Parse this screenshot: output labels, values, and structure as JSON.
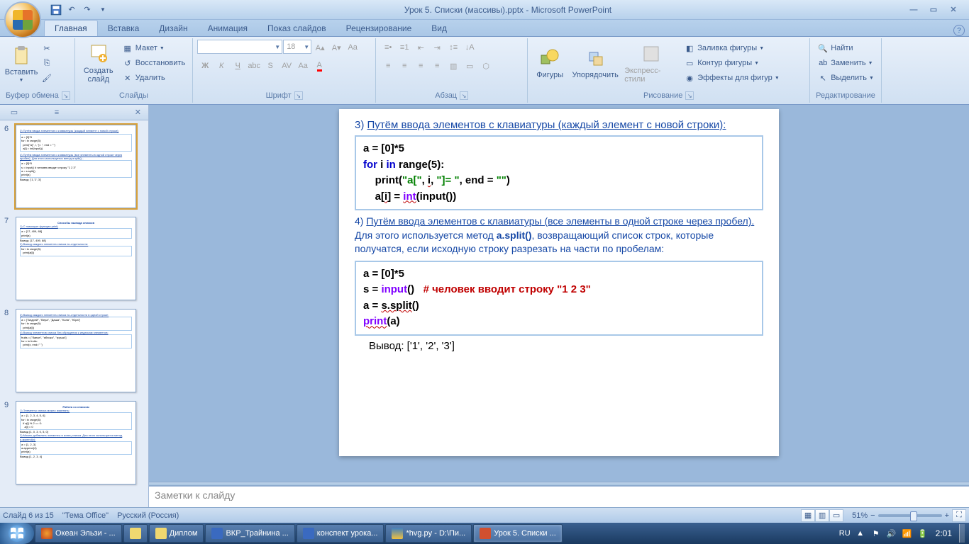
{
  "title": "Урок 5. Списки (массивы).pptx - Microsoft PowerPoint",
  "tabs": {
    "home": "Главная",
    "insert": "Вставка",
    "design": "Дизайн",
    "anim": "Анимация",
    "show": "Показ слайдов",
    "review": "Рецензирование",
    "view": "Вид"
  },
  "ribbon": {
    "clipboard": {
      "label": "Буфер обмена",
      "paste": "Вставить"
    },
    "slides": {
      "label": "Слайды",
      "new": "Создать\nслайд",
      "layout": "Макет",
      "reset": "Восстановить",
      "delete": "Удалить"
    },
    "font": {
      "label": "Шрифт",
      "size": "18"
    },
    "para": {
      "label": "Абзац"
    },
    "draw": {
      "label": "Рисование",
      "shapes": "Фигуры",
      "arrange": "Упорядочить",
      "styles": "Экспресс-стили",
      "fill": "Заливка фигуры",
      "outline": "Контур фигуры",
      "effects": "Эффекты для фигур"
    },
    "edit": {
      "label": "Редактирование",
      "find": "Найти",
      "replace": "Заменить",
      "select": "Выделить"
    }
  },
  "thumbs": {
    "n6": "6",
    "n7": "7",
    "n8": "8",
    "n9": "9",
    "t7_title": "Способы вывода списков",
    "t9_title": "Работа со списком"
  },
  "slide": {
    "h3_prefix": "3) ",
    "h3_u": "Путём ввода элементов с клавиатуры (каждый элемент с новой строки):",
    "code1_l1a": "a = [0]*5",
    "code1_l2_for": "for",
    "code1_l2_i": " i ",
    "code1_l2_in": "in",
    "code1_l2_rest": " range(5):",
    "code1_l3a": "    print(",
    "code1_l3b": "\"a[\"",
    "code1_l3c": ", ",
    "code1_l3_i": "i",
    "code1_l3d": ", ",
    "code1_l3e": "\"]= \"",
    "code1_l3f": ", end = ",
    "code1_l3g": "\"\"",
    "code1_l3h": ")",
    "code1_l4a": "    a[",
    "code1_l4_i": "i",
    "code1_l4b": "] = ",
    "code1_l4_int": "int",
    "code1_l4c": "(input())",
    "h4_prefix": "4) ",
    "h4_u1": "Путём ввода элементов с клавиатуры (все элементы в одной строке через пробел).",
    "h4_rest": " Для этого используется метод ",
    "h4_split": "a.split()",
    "h4_rest2": ", возвращающий список строк, которые получатся, если исходную строку разрезать на части по пробелам:",
    "code2_l1": "a = [0]*5",
    "code2_l2a": "s = ",
    "code2_l2_inp": "input",
    "code2_l2b": "()   ",
    "code2_l2_com": "# человек вводит строку \"1 2 3\"",
    "code2_l3a": "a = ",
    "code2_l3_split": "s.split",
    "code2_l3b": "()",
    "code2_l4a": "print",
    "code2_l4b": "(a)",
    "output": "Вывод: ['1', '2', '3']"
  },
  "notes": "Заметки к слайду",
  "status": {
    "slide": "Слайд 6 из 15",
    "theme": "\"Тема Office\"",
    "lang": "Русский (Россия)",
    "zoom": "51%"
  },
  "taskbar": {
    "t1": "Океан Эльзи - ...",
    "t2": "Диплом",
    "t3": "ВКР_Трайнина ...",
    "t4": "конспект урока...",
    "t5": "*hvg.py - D:\\Пи...",
    "t6": "Урок 5. Списки ...",
    "lang": "RU",
    "time": "2:01"
  }
}
